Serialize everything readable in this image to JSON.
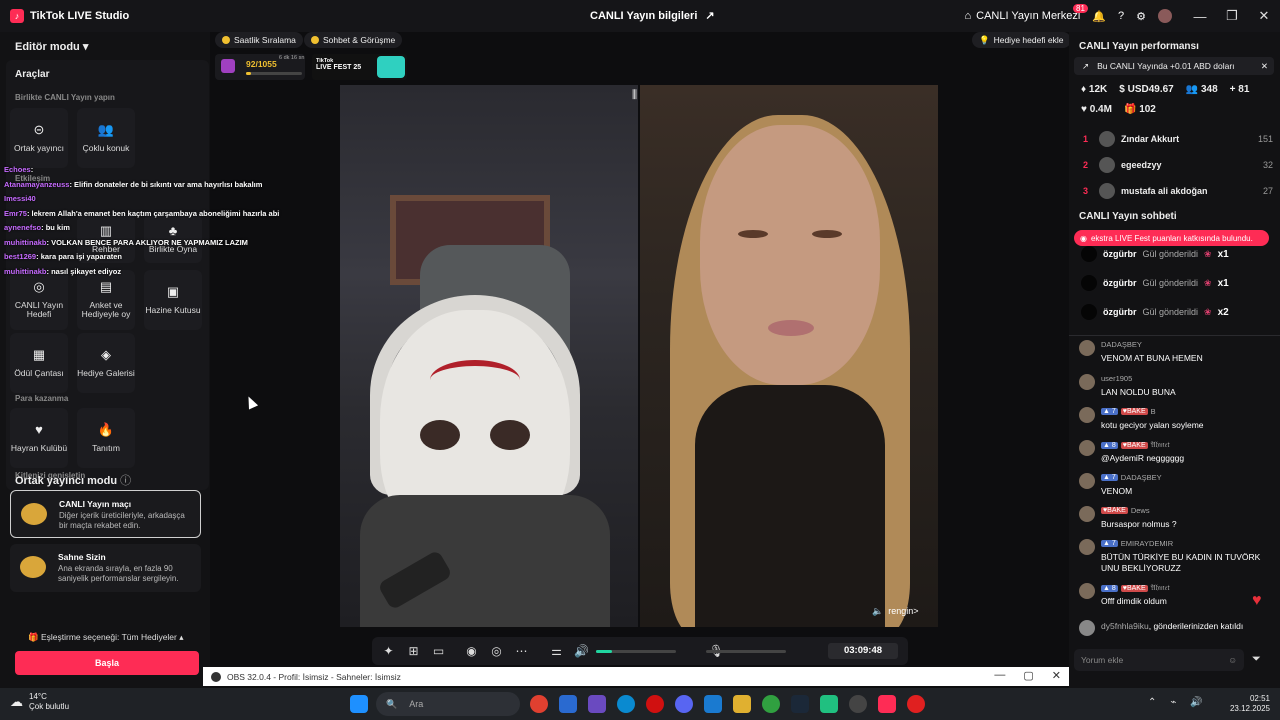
{
  "app": {
    "title": "TikTok LIVE Studio",
    "logo_text": "♪"
  },
  "header": {
    "center_title": "CANLI Yayın bilgileri",
    "live_center": "CANLI Yayın Merkezi",
    "notifications_count": "81"
  },
  "left": {
    "editor_mode": "Editör modu",
    "tools_heading": "Araçlar",
    "together_heading": "Birlikte CANLI Yayın yapın",
    "tools": [
      {
        "label": "Ortak yayıncı",
        "icon": "⊝"
      },
      {
        "label": "Çoklu konuk",
        "icon": "👥"
      },
      {
        "label": "Rehber",
        "icon": "▥"
      },
      {
        "label": "Birlikte Oyna",
        "icon": "♣"
      },
      {
        "label": "CANLI Yayın Hedefi",
        "icon": "◎"
      },
      {
        "label": "Anket ve Hediyeyle oy",
        "icon": "▤"
      },
      {
        "label": "Hazine Kutusu",
        "icon": "▣"
      },
      {
        "label": "Ödül Çantası",
        "icon": "▦"
      },
      {
        "label": "Hediye Galerisi",
        "icon": "◈"
      },
      {
        "label": "Hayran Kulübü",
        "icon": "♥"
      },
      {
        "label": "Tanıtım",
        "icon": "🔥"
      }
    ],
    "interaction_heading": "Etkileşim",
    "money_heading": "Para kazanma",
    "audience_heading": "Kitlenizi genişletin",
    "cohost_mode": "Ortak yayıncı modu",
    "modes": [
      {
        "title": "CANLI Yayın maçı",
        "desc": "Diğer içerik üreticileriyle, arkadaşça bir maçta rekabet edin."
      },
      {
        "title": "Sahne Sizin",
        "desc": "Ana ekranda sırayla, en fazla 90 saniyelik performanslar sergileyin."
      }
    ],
    "matching": "Eşleştirme seçeneği: Tüm Hediyeler",
    "start_button": "Başla"
  },
  "overlay_chat": [
    {
      "name": "Echoes",
      "text": ":"
    },
    {
      "name": "Atanamayanzeuss",
      "text": ": Elifin donateler de bi sıkıntı var ama hayırlısı bakalım"
    },
    {
      "name": "Imessi40",
      "text": ""
    },
    {
      "name": "Emr75",
      "text": ": lekrem Allah'a emanet ben kaçtım çarşambaya aboneliğimi hazırla abi"
    },
    {
      "name": "aynenefso",
      "text": ": bu kim"
    },
    {
      "name": "muhittinakb",
      "text": ": VOLKAN BENCE PARA AKLIYOR NE YAPMAMIZ LAZIM"
    },
    {
      "name": "best1269",
      "text": ": kara para işi yaparaten"
    },
    {
      "name": "muhittinakb",
      "text": ": nasıl şikayet ediyoz"
    }
  ],
  "chips": {
    "hourly": "Saatlik Sıralama",
    "chat_meet": "Sohbet & Görüşme",
    "gift_goal": "Hediye hedefi ekle"
  },
  "goal": {
    "value": "92/1055",
    "progress": 0.087,
    "timer_small": "6 dk 16 sn"
  },
  "fest": {
    "line1": "TikTok",
    "line2": "LIVE FEST 25"
  },
  "video": {
    "right_label": "rengin>"
  },
  "controls": {
    "timer": "03:09:48",
    "volume": 0.2,
    "mic": 0.0
  },
  "perf": {
    "title": "CANLI Yayın performansı",
    "banner": "Bu CANLI Yayında +0.01 ABD doları",
    "stats1": [
      "12K",
      "USD49.67",
      "348",
      "81"
    ],
    "stats2": [
      "0.4M",
      "102"
    ],
    "ranks": [
      {
        "n": "1",
        "name": "Zındar Akkurt",
        "score": "151"
      },
      {
        "n": "2",
        "name": "egeedzyy",
        "score": "32"
      },
      {
        "n": "3",
        "name": "mustafa ali akdoğan",
        "score": "27"
      }
    ]
  },
  "chat": {
    "title": "CANLI Yayın sohbeti",
    "fest_banner": "ekstra LIVE Fest puanları katkısında bulundu.",
    "gifts": [
      {
        "user": "özgürbr",
        "action": "Gül gönderildi",
        "mult": "x1"
      },
      {
        "user": "özgürbr",
        "action": "Gül gönderildi",
        "mult": "x1"
      },
      {
        "user": "özgürbr",
        "action": "Gül gönderildi",
        "mult": "x2"
      }
    ],
    "messages": [
      {
        "lv": "",
        "bk": "",
        "user": "DADAŞBEY",
        "text": "VENOM AT BUNA HEMEN"
      },
      {
        "lv": "",
        "bk": "",
        "user": "user1905",
        "text": "LAN NOLDU BUNA"
      },
      {
        "lv": "7",
        "bk": "BAKE",
        "user": "B",
        "text": "kotu geciyor yalan soyleme"
      },
      {
        "lv": "8",
        "bk": "BAKE",
        "user": "𝔄𝔥𝔪𝔢𝔱",
        "text": "@AydemiR negggggg"
      },
      {
        "lv": "7",
        "bk": "",
        "user": "DADAŞBEY",
        "text": "VENOM"
      },
      {
        "lv": "",
        "bk": "BAKE",
        "user": "Dews",
        "text": "Bursaspor nolmus ?"
      },
      {
        "lv": "7",
        "bk": "",
        "user": "EMIRAYDEMIR",
        "text": "BÜTÜN TÜRKİYE BU KADIN IN TUVÖRK UNU BEKLİYORUZZ"
      },
      {
        "lv": "8",
        "bk": "BAKE",
        "user": "𝔄𝔥𝔪𝔢𝔱",
        "text": "Offf dimdik oldum"
      }
    ],
    "join": {
      "user": "dy5fnhla9iku",
      "text": ", gönderilerinizden katıldı"
    },
    "input_placeholder": "Yorum ekle"
  },
  "obs": {
    "title": "OBS 32.0.4 - Profil: İsimsiz - Sahneler: İsimsiz"
  },
  "taskbar": {
    "temp": "14°C",
    "weather": "Çok bulutlu",
    "search": "Ara",
    "time": "02:51",
    "date": "23.12.2025"
  }
}
